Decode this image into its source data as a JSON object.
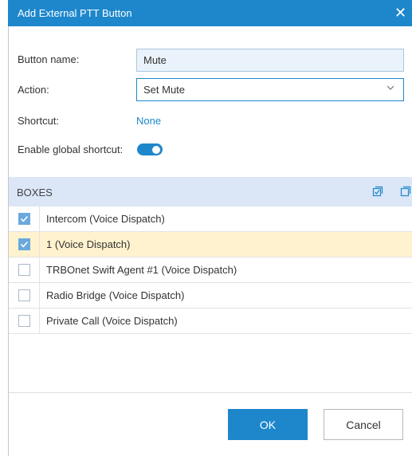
{
  "dialog": {
    "title": "Add External PTT Button",
    "close_glyph": "✕"
  },
  "form": {
    "button_name": {
      "label": "Button name:",
      "value": "Mute"
    },
    "action": {
      "label": "Action:",
      "value": "Set Mute"
    },
    "shortcut": {
      "label": "Shortcut:",
      "value": "None"
    },
    "global_shortcut": {
      "label": "Enable global shortcut:",
      "enabled": true
    }
  },
  "boxes": {
    "title": "BOXES",
    "items": [
      {
        "label": "Intercom (Voice Dispatch)",
        "checked": true,
        "selected": false
      },
      {
        "label": "1 (Voice Dispatch)",
        "checked": true,
        "selected": true
      },
      {
        "label": "TRBOnet Swift Agent #1 (Voice Dispatch)",
        "checked": false,
        "selected": false
      },
      {
        "label": "Radio Bridge (Voice Dispatch)",
        "checked": false,
        "selected": false
      },
      {
        "label": "Private Call (Voice Dispatch)",
        "checked": false,
        "selected": false
      }
    ]
  },
  "buttons": {
    "ok": "OK",
    "cancel": "Cancel"
  },
  "colors": {
    "accent": "#1e87cc",
    "header_bg": "#dbe6f7",
    "selected_row": "#fff2cf",
    "checkbox_checked": "#6aa9de"
  },
  "icons": {
    "header_left": "select-all-icon",
    "header_right": "copy-icon",
    "action_dropdown": "chevron-down-icon"
  }
}
